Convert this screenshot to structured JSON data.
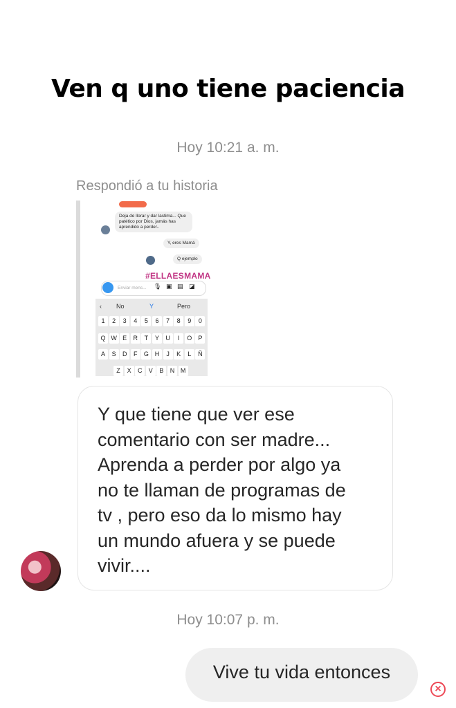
{
  "title": "Ven q uno tiene paciencia",
  "timestamp_1": "Hoy 10:21 a. m.",
  "replied_label": "Respondió a tu historia",
  "story": {
    "bubble_1": "Deja de llorar y dar lastima... Que patético por Dios, jamás has aprendido a perder..",
    "bubble_2": "Y, eres Mamá",
    "bubble_3": "Q ejemplo",
    "hashtag": "#ELLAESMAMA",
    "input_placeholder": "Enviar mens...",
    "suggestions": [
      "No",
      "Y",
      "Pero"
    ],
    "row_numbers": [
      "1",
      "2",
      "3",
      "4",
      "5",
      "6",
      "7",
      "8",
      "9",
      "0"
    ],
    "row_q": [
      "Q",
      "W",
      "E",
      "R",
      "T",
      "Y",
      "U",
      "I",
      "O",
      "P"
    ],
    "row_a": [
      "A",
      "S",
      "D",
      "F",
      "G",
      "H",
      "J",
      "K",
      "L",
      "Ñ"
    ],
    "row_z": [
      "Z",
      "X",
      "C",
      "V",
      "B",
      "N",
      "M"
    ]
  },
  "incoming_message": "Y que tiene que ver ese\ncomentario con ser madre...\nAprenda a perder por algo ya\nno te llaman  de programas de\ntv , pero eso da lo mismo hay\nun mundo afuera y se puede\nvivir....",
  "timestamp_2": "Hoy 10:07 p. m.",
  "outgoing_message": "Vive tu vida entonces",
  "error_icon_glyph": "×",
  "colors": {
    "accent_pink": "#c13584",
    "error_red": "#ed4956",
    "timestamp_gray": "#8e8e8e"
  }
}
